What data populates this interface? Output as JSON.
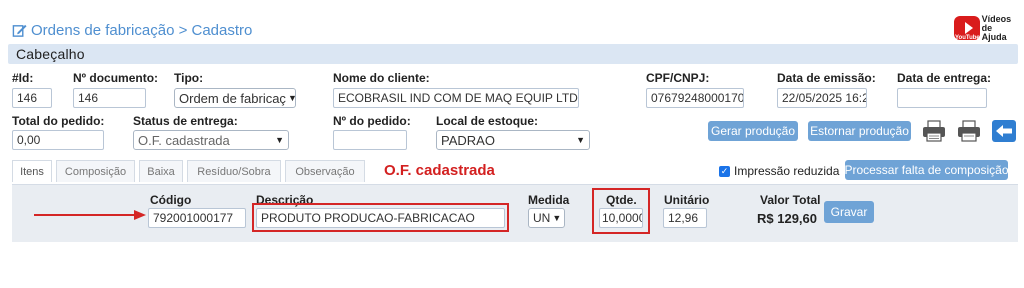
{
  "breadcrumb": "Ordens de fabricação > Cadastro",
  "help_video": {
    "line1": "Vídeos",
    "line2": "de Ajuda",
    "yt_text": "YouTube"
  },
  "section_title": "Cabeçalho",
  "fields": {
    "id": {
      "label": "#Id:",
      "value": "146"
    },
    "doc_number": {
      "label": "Nº documento:",
      "value": "146"
    },
    "type": {
      "label": "Tipo:",
      "value": "Ordem de fabricaç"
    },
    "client_name": {
      "label": "Nome do cliente:",
      "value": "ECOBRASIL IND COM DE MAQ EQUIP LTDA"
    },
    "cpf_cnpj": {
      "label": "CPF/CNPJ:",
      "value": "07679248000170"
    },
    "issue_date": {
      "label": "Data de emissão:",
      "value": "22/05/2025 16:2"
    },
    "delivery_date": {
      "label": "Data de entrega:",
      "value": ""
    },
    "order_total": {
      "label": "Total do pedido:",
      "value": "0,00"
    },
    "delivery_status": {
      "label": "Status de entrega:",
      "value": "O.F. cadastrada"
    },
    "order_number": {
      "label": "Nº do pedido:",
      "value": ""
    },
    "stock_location": {
      "label": "Local de estoque:",
      "value": "PADRAO"
    }
  },
  "buttons": {
    "generate_production": "Gerar produção",
    "reverse_production": "Estornar produção",
    "process_shortage": "Processar falta de composição",
    "save": "Gravar"
  },
  "tabs": [
    "Itens",
    "Composição",
    "Baixa",
    "Resíduo/Sobra",
    "Observação"
  ],
  "status_text": "O.F. cadastrada",
  "reduced_print": {
    "label": "Impressão reduzida",
    "checked": true
  },
  "item": {
    "code_label": "Código",
    "code_value": "792001000177",
    "desc_label": "Descrição",
    "desc_value": "PRODUTO PRODUCAO-FABRICACAO",
    "unit_label": "Medida",
    "unit_value": "UN",
    "qty_label": "Qtde.",
    "qty_value": "10,0000",
    "unit_price_label": "Unitário",
    "unit_price_value": "12,96",
    "total_label": "Valor Total",
    "total_value": "R$ 129,60"
  },
  "colors": {
    "accent": "#4f8fd0",
    "button": "#6fa3d6",
    "status_red": "#d32020",
    "annotation_red": "#d42626",
    "section_bg": "#dbe6f3"
  }
}
